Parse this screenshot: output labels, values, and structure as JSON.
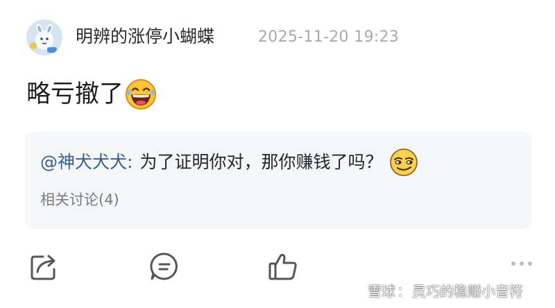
{
  "post": {
    "author": "明辨的涨停小蝴蝶",
    "timestamp": "2025-11-20 19:23",
    "text": "略亏撤了",
    "emoji": "laughing-face-emoji"
  },
  "quote": {
    "mention": "@神犬犬犬:",
    "text": "为了证明你对，那你赚钱了吗？",
    "emoji": "smug-face-emoji",
    "related": "相关讨论(4)"
  },
  "actions": [
    "share-icon",
    "comment-icon",
    "like-icon",
    "more-icon"
  ],
  "watermark": {
    "brand": "雪球",
    "separator": "：",
    "account": "灵巧的稳赚小音符"
  },
  "colors": {
    "mention": "#3a5e8c",
    "timestamp": "#a9a9a9",
    "quote_bg": "#f5f6f8",
    "icon": "#555555"
  }
}
